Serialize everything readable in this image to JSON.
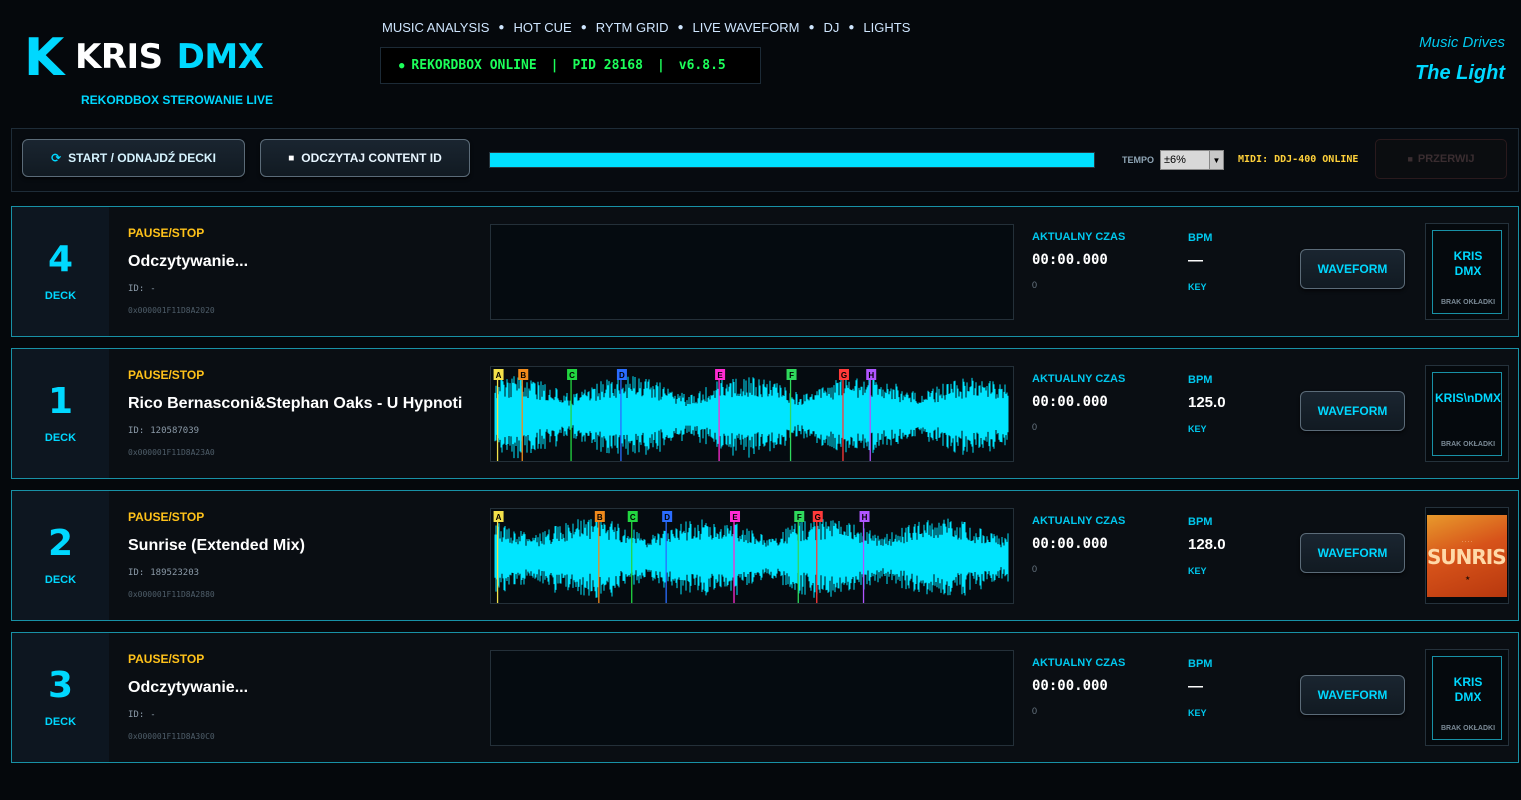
{
  "header": {
    "logo_letter": "K",
    "logo_word1": "KRIS",
    "logo_word2": "DMX",
    "subtitle": "REKORDBOX STEROWANIE LIVE",
    "tagline_1": "Music Drives",
    "tagline_2": "The Light"
  },
  "nav": [
    "MUSIC ANALYSIS",
    "HOT CUE",
    "RYTM GRID",
    "LIVE WAVEFORM",
    "DJ",
    "LIGHTS"
  ],
  "status": {
    "dot": "●",
    "online": "REKORDBOX ONLINE",
    "pid": "PID 28168",
    "version": "v6.8.5",
    "color": "#1cff5a"
  },
  "toolbar": {
    "start_icon": "⟳",
    "start_label": "START / ODNAJDŹ DECKI",
    "content_icon": "■",
    "content_label": "ODCZYTAJ CONTENT ID",
    "progress_fraction": 1.0,
    "tempo_label": "TEMPO",
    "tempo_value": "±6%",
    "tempo_arrow": "▼",
    "midi_status": "MIDI: DDJ-400 ONLINE",
    "stop_icon": "■",
    "stop_label": "PRZERWIJ"
  },
  "labels": {
    "deck": "DECK",
    "id": "ID:",
    "time": "AKTUALNY CZAS",
    "bpm": "BPM",
    "key": "KEY",
    "waveform_button": "WAVEFORM",
    "no_cover": "BRAK OKŁADKI"
  },
  "decks": [
    {
      "number": "4",
      "state": "PAUSE/STOP",
      "title": "Odczytywanie...",
      "id": "-",
      "hex": "0x000001F11D8A2020",
      "time": "00:00.000",
      "time_sub": "0",
      "bpm": "—",
      "cover": "placeholder",
      "cover_text": "KRIS\nDMX",
      "waveform": false,
      "cues": []
    },
    {
      "number": "1",
      "state": "PAUSE/STOP",
      "title": "Rico Bernasconi&Stephan Oaks - U Hypnoti",
      "id": "120587039",
      "hex": "0x000001F11D8A23A0",
      "time": "00:00.000",
      "time_sub": "0",
      "bpm": "125.0",
      "cover": "placeholder",
      "cover_text": "KRIS\\nDMX",
      "waveform": true,
      "cues": [
        {
          "label": "A",
          "pos": 0.005,
          "color": "#f3e14a"
        },
        {
          "label": "B",
          "pos": 0.053,
          "color": "#f08a1c"
        },
        {
          "label": "C",
          "pos": 0.148,
          "color": "#22d640"
        },
        {
          "label": "D",
          "pos": 0.245,
          "color": "#2a6cff"
        },
        {
          "label": "E",
          "pos": 0.436,
          "color": "#ff2bd1"
        },
        {
          "label": "F",
          "pos": 0.575,
          "color": "#2fd95c"
        },
        {
          "label": "G",
          "pos": 0.677,
          "color": "#ff3a3a"
        },
        {
          "label": "H",
          "pos": 0.73,
          "color": "#b055ff"
        }
      ]
    },
    {
      "number": "2",
      "state": "PAUSE/STOP",
      "title": "Sunrise (Extended Mix)",
      "id": "189523203",
      "hex": "0x000001F11D8A2880",
      "time": "00:00.000",
      "time_sub": "0",
      "bpm": "128.0",
      "cover": "art",
      "cover_text": "SUNRISE",
      "waveform": true,
      "cues": [
        {
          "label": "A",
          "pos": 0.005,
          "color": "#f3e14a"
        },
        {
          "label": "B",
          "pos": 0.202,
          "color": "#f08a1c"
        },
        {
          "label": "C",
          "pos": 0.266,
          "color": "#22d640"
        },
        {
          "label": "D",
          "pos": 0.333,
          "color": "#2a6cff"
        },
        {
          "label": "E",
          "pos": 0.465,
          "color": "#ff2bd1"
        },
        {
          "label": "F",
          "pos": 0.59,
          "color": "#2fd95c"
        },
        {
          "label": "G",
          "pos": 0.626,
          "color": "#ff3a3a"
        },
        {
          "label": "H",
          "pos": 0.717,
          "color": "#b055ff"
        }
      ]
    },
    {
      "number": "3",
      "state": "PAUSE/STOP",
      "title": "Odczytywanie...",
      "id": "-",
      "hex": "0x000001F11D8A30C0",
      "time": "00:00.000",
      "time_sub": "0",
      "bpm": "—",
      "cover": "placeholder",
      "cover_text": "KRIS\nDMX",
      "waveform": false,
      "cues": []
    }
  ],
  "colors": {
    "accent": "#00d8ff",
    "state": "#ffc21a",
    "waveform": "#00e5ff",
    "midi": "#ffd13a"
  }
}
